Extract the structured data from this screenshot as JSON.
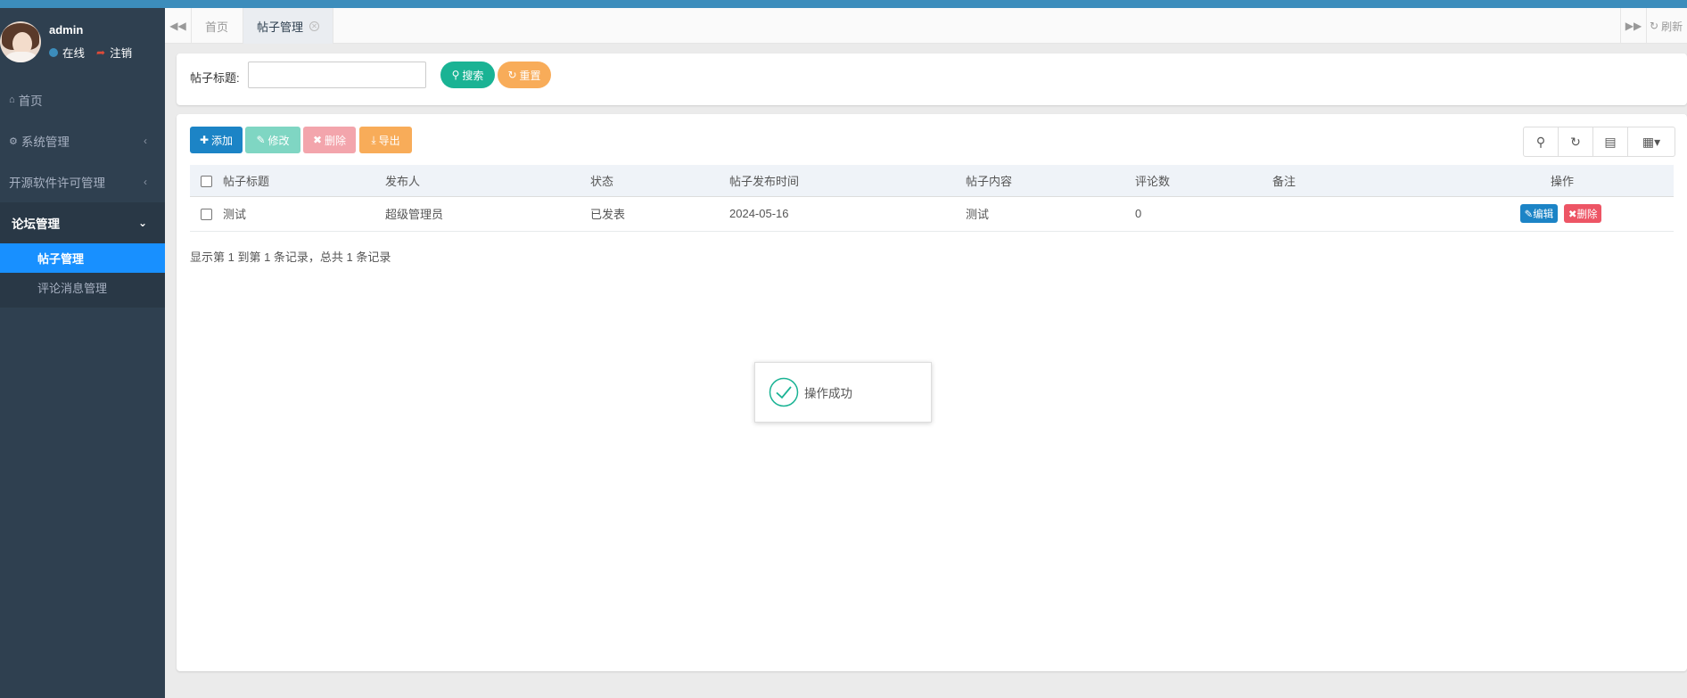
{
  "user": {
    "name": "admin",
    "status": "在线",
    "logout": "注销"
  },
  "sidebar": {
    "items": [
      {
        "label": "首页",
        "icon": "home-icon"
      },
      {
        "label": "系统管理",
        "icon": "gear-icon"
      },
      {
        "label": "开源软件许可管理"
      },
      {
        "label": "论坛管理"
      }
    ],
    "submenu": [
      "帖子管理",
      "评论消息管理"
    ]
  },
  "tabs": {
    "home": "首页",
    "active": "帖子管理",
    "refresh": "刷新"
  },
  "search": {
    "label": "帖子标题:",
    "value": "",
    "search_btn": "搜索",
    "reset_btn": "重置"
  },
  "toolbar": {
    "add": "添加",
    "edit": "修改",
    "delete": "删除",
    "export": "导出"
  },
  "table": {
    "columns": [
      "帖子标题",
      "发布人",
      "状态",
      "帖子发布时间",
      "帖子内容",
      "评论数",
      "备注",
      "操作"
    ],
    "rows": [
      {
        "title": "测试",
        "author": "超级管理员",
        "status": "已发表",
        "time": "2024-05-16",
        "content": "测试",
        "comments": "0",
        "remark": "",
        "edit": "编辑",
        "delete": "删除"
      }
    ],
    "pagination": "显示第 1 到第 1 条记录，总共 1 条记录"
  },
  "toast": {
    "message": "操作成功"
  },
  "colors": {
    "sidebar_bg": "#2f4050",
    "active_sub": "#1890ff",
    "primary": "#1c84c6",
    "success": "#1ab394",
    "warning": "#f8ac59",
    "danger": "#ed5565"
  }
}
